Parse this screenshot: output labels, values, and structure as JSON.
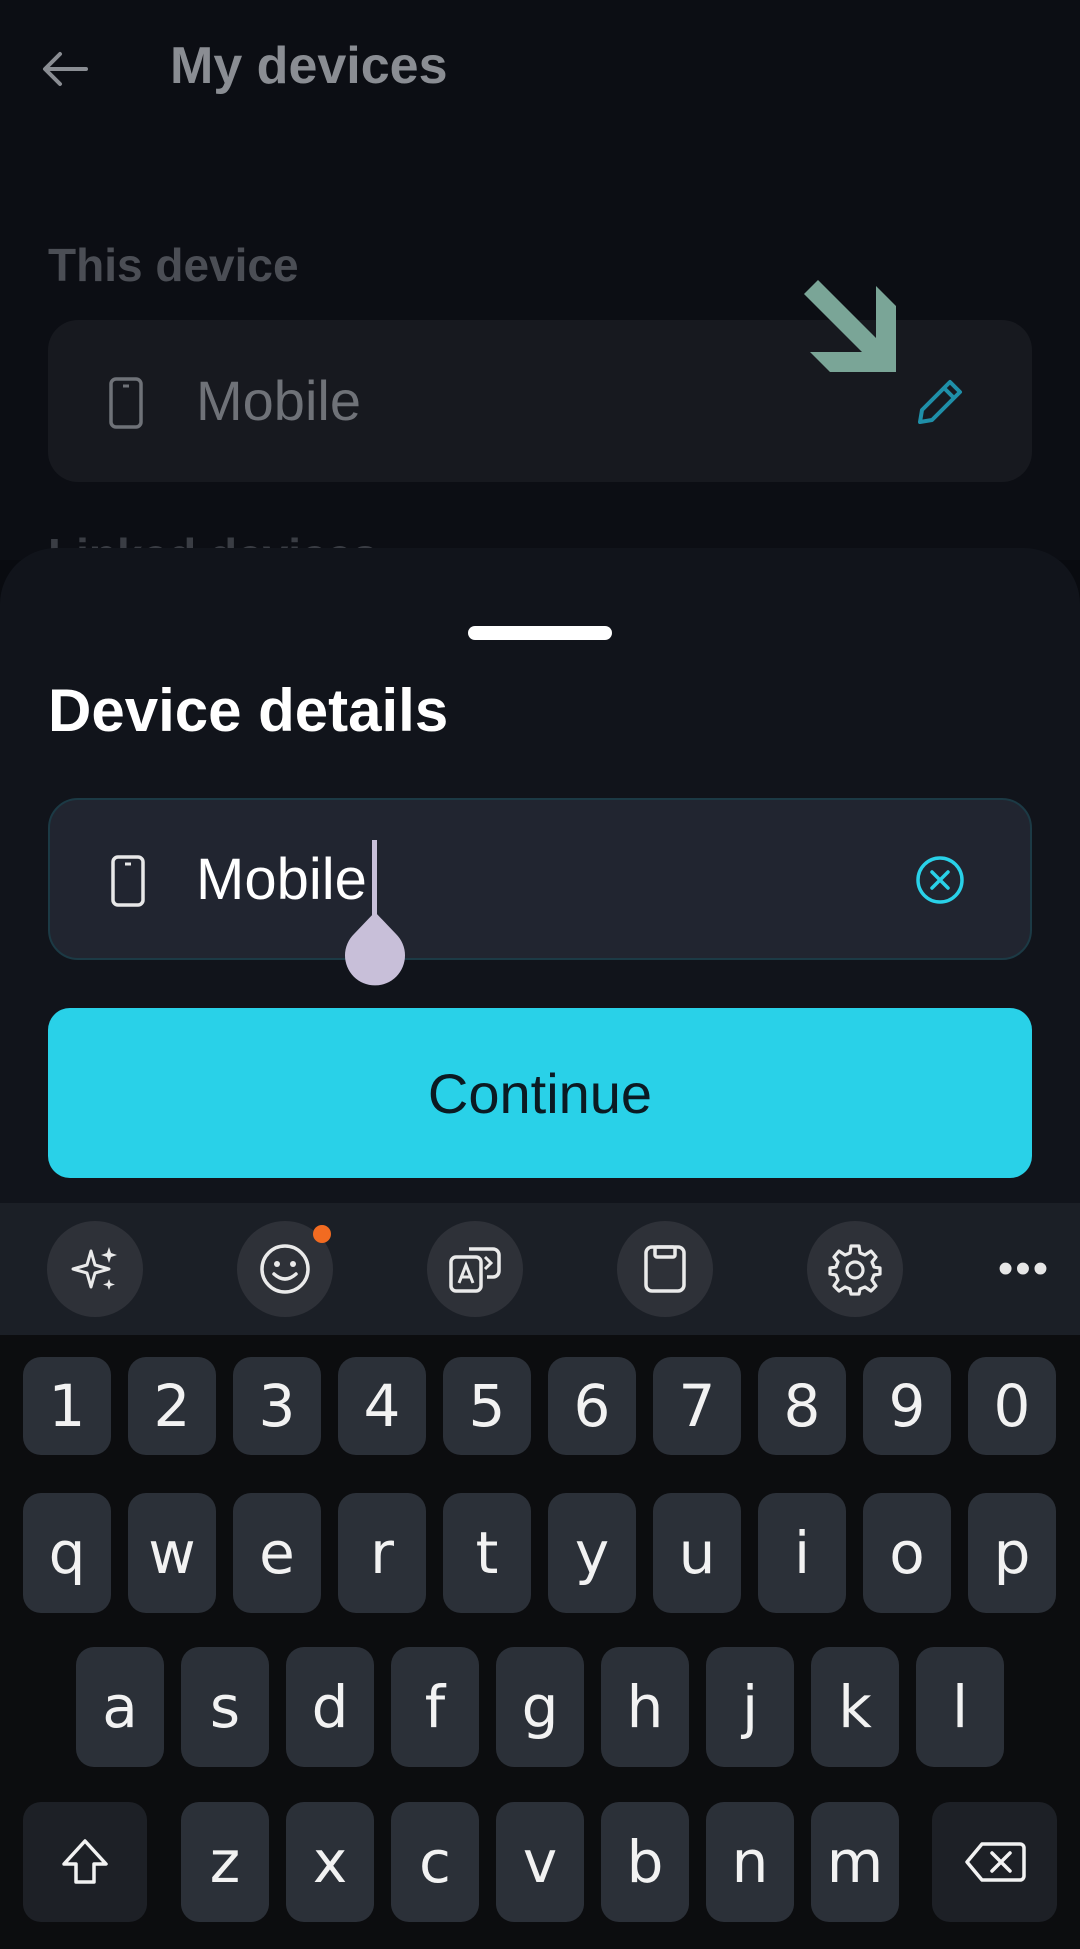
{
  "background": {
    "page_title": "My devices",
    "section_label": "This device",
    "device_name": "Mobile",
    "peek_text": "Linked devices"
  },
  "sheet": {
    "title": "Device details",
    "field_value": "Mobile",
    "continue_label": "Continue"
  },
  "toolbar": {
    "icons": [
      "sparkle-icon",
      "emoji-icon",
      "translate-icon",
      "clipboard-icon",
      "settings-icon"
    ],
    "more_label": "•••"
  },
  "keyboard": {
    "row_numbers": [
      "1",
      "2",
      "3",
      "4",
      "5",
      "6",
      "7",
      "8",
      "9",
      "0"
    ],
    "row_1": [
      "q",
      "w",
      "e",
      "r",
      "t",
      "y",
      "u",
      "i",
      "o",
      "p"
    ],
    "row_2": [
      "a",
      "s",
      "d",
      "f",
      "g",
      "h",
      "j",
      "k",
      "l"
    ],
    "row_3": [
      "z",
      "x",
      "c",
      "v",
      "b",
      "n",
      "m"
    ]
  },
  "colors": {
    "accent": "#29d1e8",
    "notification_dot": "#f26b21",
    "edit_icon": "#1f8fa8",
    "hint_arrow": "#7aa597"
  }
}
